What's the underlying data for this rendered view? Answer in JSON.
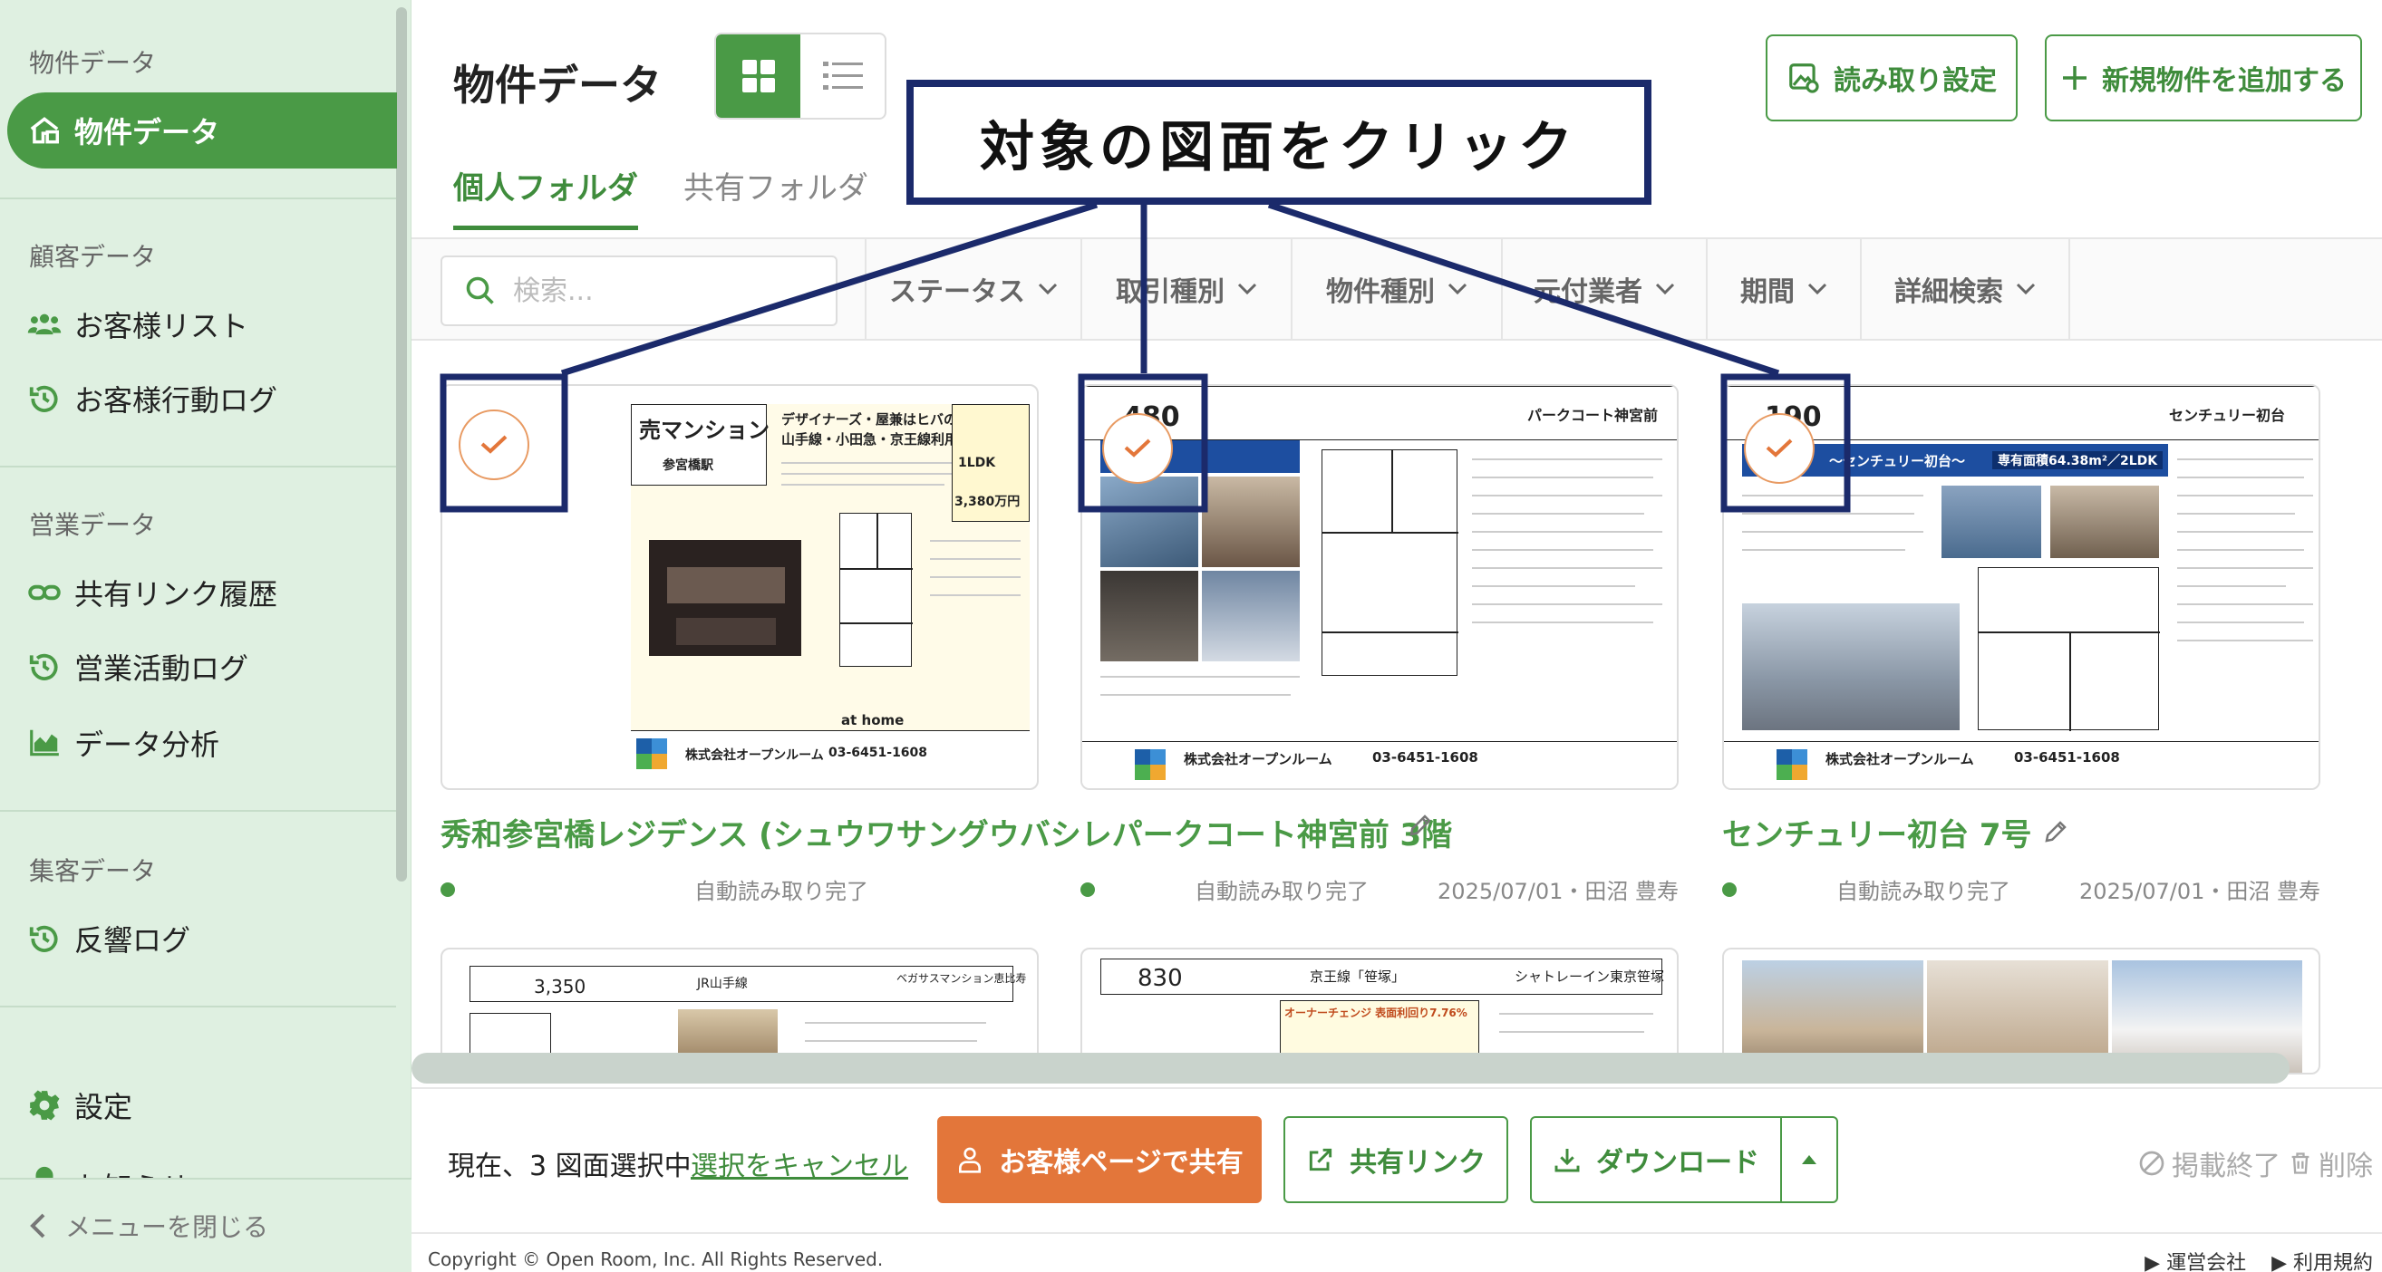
{
  "sidebar": {
    "sections": [
      {
        "title": "物件データ",
        "items": [
          {
            "label": "物件データ"
          }
        ]
      },
      {
        "title": "顧客データ",
        "items": [
          {
            "label": "お客様リスト"
          },
          {
            "label": "お客様行動ログ"
          }
        ]
      },
      {
        "title": "営業データ",
        "items": [
          {
            "label": "共有リンク履歴"
          },
          {
            "label": "営業活動ログ"
          },
          {
            "label": "データ分析"
          }
        ]
      },
      {
        "title": "集客データ",
        "items": [
          {
            "label": "反響ログ"
          }
        ]
      }
    ],
    "settings_label": "設定",
    "notice_label": "お知らせ",
    "close_menu_label": "メニューを閉じる"
  },
  "header": {
    "title": "物件データ",
    "read_settings_label": "読み取り設定",
    "add_property_label": "新規物件を追加する"
  },
  "tabs": [
    {
      "label": "個人フォルダ",
      "active": true
    },
    {
      "label": "共有フォルダ",
      "active": false
    }
  ],
  "filters": {
    "search_placeholder": "検索...",
    "items": [
      {
        "label": "ステータス"
      },
      {
        "label": "取引種別"
      },
      {
        "label": "物件種別"
      },
      {
        "label": "元付業者"
      },
      {
        "label": "期間"
      },
      {
        "label": "詳細検索"
      }
    ]
  },
  "cards": [
    {
      "title": "秀和参宮橋レジデンス (シュウワサングウバシレジデンス)",
      "status": "自動読み取り完了",
      "date": "",
      "selected": true,
      "flyer": {
        "headline": "売マンション",
        "station": "参宮橋駅",
        "desc1": "デザイナーズ・屋兼はヒバの木",
        "desc2": "山手線・小田急・京王線利用可能",
        "layout": "1LDK",
        "price": "3,380万円",
        "company": "株式会社オープンルーム",
        "phone": "03-6451-1608",
        "brand": "at home"
      }
    },
    {
      "title": "パークコート神宮前 3階",
      "status": "自動読み取り完了",
      "date": "2025/07/01・田沼 豊寿",
      "selected": true,
      "flyer": {
        "price": "480",
        "name": "パークコート神宮前",
        "company": "株式会社オープンルーム",
        "phone": "03-6451-1608"
      }
    },
    {
      "title": "センチュリー初台 7号",
      "status": "自動読み取り完了",
      "date": "2025/07/01・田沼 豊寿",
      "selected": true,
      "flyer": {
        "price": "190",
        "name": "センチュリー初台",
        "banner": "〜センチュリー初台〜",
        "area": "専有面積64.38m²／2LDK",
        "company": "株式会社オープンルーム",
        "phone": "03-6451-1608"
      }
    }
  ],
  "cards_row2": [
    {
      "price": "3,350",
      "name": "ベガサスマンション恵比寿",
      "line": "JR山手線"
    },
    {
      "price": "830",
      "name": "シャトレーイン東京笹塚",
      "line": "京王線「笹塚」",
      "banner": "オーナーチェンジ 表面利回り7.76%"
    },
    {
      "name": "photo"
    }
  ],
  "callout": {
    "text": "対象の図面をクリック"
  },
  "actionbar": {
    "selection_text": "現在、3 図面選択中",
    "cancel_label": "選択をキャンセル",
    "share_customer_label": "お客様ページで共有",
    "share_link_label": "共有リンク",
    "download_label": "ダウンロード",
    "end_listing_label": "掲載終了",
    "delete_label": "削除"
  },
  "footer": {
    "copyright": "Copyright © Open Room, Inc. All Rights Reserved.",
    "company_link": "▶ 運営会社",
    "terms_link": "▶ 利用規約"
  },
  "colors": {
    "brand_green": "#4a9a46",
    "accent_orange": "#e3763a",
    "callout_navy": "#1b2a6b"
  }
}
